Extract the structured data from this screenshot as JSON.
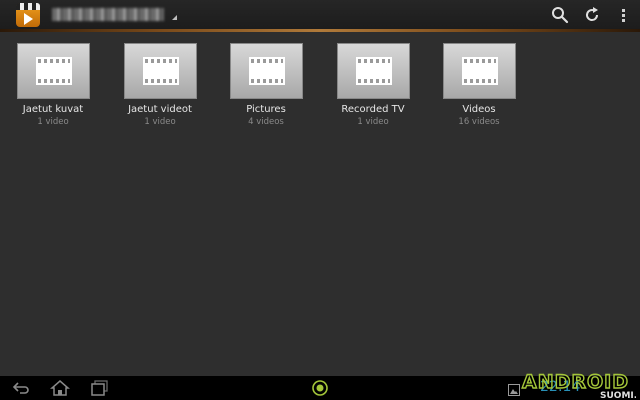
{
  "action_bar": {
    "server_name": "",
    "icons": [
      "clapperboard-play-icon",
      "search-icon",
      "refresh-icon",
      "overflow-menu-icon"
    ]
  },
  "folders": [
    {
      "title": "Jaetut kuvat",
      "count": "1 video"
    },
    {
      "title": "Jaetut videot",
      "count": "1 video"
    },
    {
      "title": "Pictures",
      "count": "4 videos"
    },
    {
      "title": "Recorded TV",
      "count": "1 video"
    },
    {
      "title": "Videos",
      "count": "16 videos"
    }
  ],
  "system_bar": {
    "icons": [
      "back-icon",
      "home-icon",
      "recent-apps-icon",
      "center-circle-icon",
      "gallery-notification-icon"
    ],
    "time": "22:14"
  },
  "watermark": {
    "logo_text": "ANDROID",
    "sub_text": "SUOMI.FI"
  },
  "colors": {
    "background": "#2e2e2e",
    "action_bar": "#1f1f1f",
    "accent_brown": "#b07a3a",
    "system_bar": "#000000",
    "system_accent": "#33b5e5",
    "watermark_green": "#a4c639"
  }
}
